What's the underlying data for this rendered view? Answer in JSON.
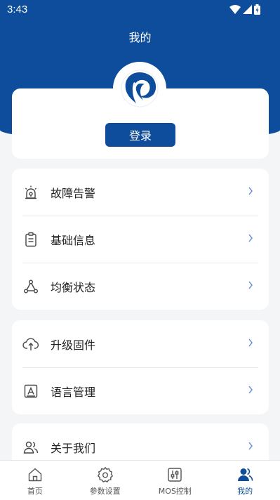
{
  "status_bar": {
    "time": "3:43"
  },
  "header": {
    "title": "我的"
  },
  "profile": {
    "login_label": "登录"
  },
  "menu_groups": [
    {
      "items": [
        {
          "label": "故障告警",
          "icon": "alarm-icon"
        },
        {
          "label": "基础信息",
          "icon": "clipboard-icon"
        },
        {
          "label": "均衡状态",
          "icon": "triangle-nodes-icon"
        }
      ]
    },
    {
      "items": [
        {
          "label": "升级固件",
          "icon": "cloud-upload-icon"
        },
        {
          "label": "语言管理",
          "icon": "language-icon"
        }
      ]
    },
    {
      "items": [
        {
          "label": "关于我们",
          "icon": "users-icon"
        }
      ]
    }
  ],
  "tabbar": {
    "tabs": [
      {
        "label": "首页",
        "icon": "home-icon"
      },
      {
        "label": "参数设置",
        "icon": "gear-icon"
      },
      {
        "label": "MOS控制",
        "icon": "sliders-icon"
      },
      {
        "label": "我的",
        "icon": "person-icon",
        "active": true
      }
    ]
  },
  "colors": {
    "brand": "#0d4d9c",
    "background": "#f4f5f7",
    "chevron": "#5b8ad6"
  }
}
